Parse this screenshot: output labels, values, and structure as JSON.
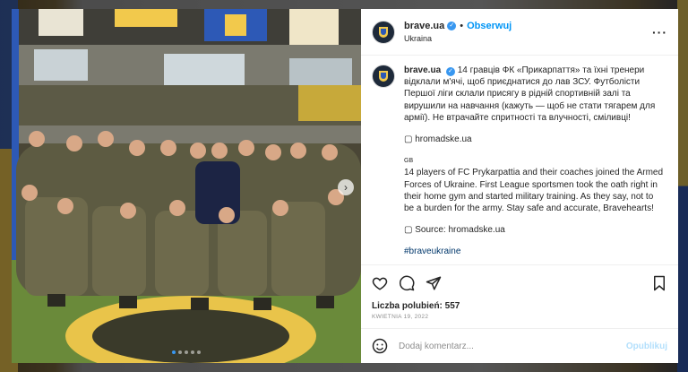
{
  "post": {
    "username": "brave.ua",
    "follow_label": "Obserwuj",
    "separator": "•",
    "location": "Ukraina",
    "more_label": "···",
    "verified_mark": "✓"
  },
  "caption": {
    "username": "brave.ua",
    "text_ua": "14 гравців ФК «Прикарпаття» та їхні тренери відклали м'ячі, щоб приєднатися до лав ЗСУ. Футболісти Першої ліги склали присягу в рідній спортивній залі та вирушили на навчання (кажуть — щоб не стати тягарем для армії). Не втрачайте спритності та влучності, сміливці!",
    "source_ua": "▢ hromadske.ua",
    "gb_tag": "GB",
    "text_en": "14 players of FC Prykarpattia and their coaches joined the Armed Forces of Ukraine. First League sportsmen took the oath right in their home gym and started military training. As they say, not to be a burden for the army. Stay safe and accurate, Bravehearts!",
    "source_en": "▢ Source: hromadske.ua",
    "hashtag": "#braveukraine"
  },
  "engagement": {
    "likes": "Liczba polubień: 557",
    "date": "KWIETNIA 19, 2022"
  },
  "comment": {
    "placeholder": "Dodaj komentarz...",
    "post_label": "Opublikuj"
  },
  "carousel": {
    "next_label": "›",
    "slide_count": 5,
    "active_index": 0
  },
  "icons": [
    "heart-icon",
    "comment-icon",
    "share-icon",
    "bookmark-icon",
    "emoji-icon",
    "chevron-right-icon",
    "verified-icon",
    "more-icon"
  ],
  "colors": {
    "accent": "#0095f6",
    "verified": "#3897f0",
    "hashtag": "#00376b",
    "muted": "#8e8e8e"
  }
}
